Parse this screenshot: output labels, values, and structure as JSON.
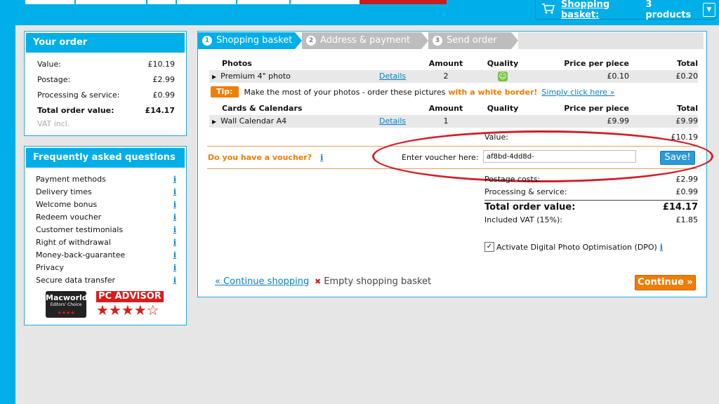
{
  "header": {
    "basket_label": "Shopping basket:",
    "basket_count": "3 products"
  },
  "order_panel": {
    "title": "Your order",
    "rows": [
      {
        "label": "Value:",
        "value": "£10.19"
      },
      {
        "label": "Postage:",
        "value": "£2.99"
      },
      {
        "label": "Processing & service:",
        "value": "£0.99"
      },
      {
        "label": "Total order value:",
        "value": "£14.17"
      }
    ],
    "vat_note": "VAT incl."
  },
  "faq_panel": {
    "title": "Frequently asked questions",
    "items": [
      "Payment methods",
      "Delivery times",
      "Welcome bonus",
      "Redeem voucher",
      "Customer testimonials",
      "Right of withdrawal",
      "Money-back-guarantee",
      "Privacy",
      "Secure data transfer"
    ],
    "info_glyph": "i",
    "badge_macworld": "Macworld",
    "badge_macworld_sub": "Editors' Choice",
    "badge_pcadvisor": "PC ADVISOR"
  },
  "steps": [
    {
      "num": "1",
      "label": "Shopping basket"
    },
    {
      "num": "2",
      "label": "Address & payment"
    },
    {
      "num": "3",
      "label": "Send order"
    }
  ],
  "photos_table": {
    "headers": [
      "Photos",
      "Amount",
      "Quality",
      "Price per piece",
      "Total"
    ],
    "row": {
      "name": "Premium 4\" photo",
      "details": "Details",
      "amount": "2",
      "price": "£0.10",
      "total": "£0.20"
    }
  },
  "tip": {
    "badge": "Tip:",
    "text": "Make the most of your photos - order these pictures",
    "highlight": "with a white border!",
    "link": "Simply click here »"
  },
  "cards_table": {
    "headers": [
      "Cards & Calendars",
      "Amount",
      "Quality",
      "Price per piece",
      "Total"
    ],
    "row": {
      "name": "Wall Calendar A4",
      "details": "Details",
      "amount": "1",
      "price": "£9.99",
      "total": "£9.99"
    }
  },
  "summary": {
    "value_label": "Value:",
    "value": "£10.19",
    "voucher_question": "Do you have a voucher?",
    "voucher_prompt": "Enter voucher here:",
    "voucher_code": "af8bd-4dd8d-",
    "save_label": "Save!",
    "postage_label": "Postage costs:",
    "postage": "£2.99",
    "processing_label": "Processing & service:",
    "processing": "£0.99",
    "total_label": "Total order value:",
    "total": "£14.17",
    "vat_label": "Included VAT (15%):",
    "vat": "£1.85",
    "dpo_label": "Activate Digital Photo Optimisation (DPO)"
  },
  "actions": {
    "continue_shopping": "« Continue shopping",
    "empty_basket": "Empty shopping basket",
    "continue": "Continue »"
  },
  "colors": {
    "accent": "#00aee8",
    "orange": "#f07d00",
    "highlight_ring": "#d21e28"
  }
}
